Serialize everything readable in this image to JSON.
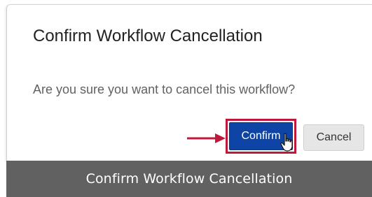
{
  "dialog": {
    "title": "Confirm Workflow Cancellation",
    "message": "Are you sure you want to cancel this workflow?",
    "confirm_label": "Confirm",
    "cancel_label": "Cancel"
  },
  "caption": {
    "text": "Confirm Workflow Cancellation"
  },
  "annotation": {
    "arrow_icon": "arrow-right-icon",
    "highlight_color": "#c0183a",
    "cursor_icon": "hand-pointer-icon"
  },
  "colors": {
    "confirm_bg": "#0e44a6",
    "cancel_bg": "#e6e6e6",
    "caption_bg": "#616161"
  }
}
